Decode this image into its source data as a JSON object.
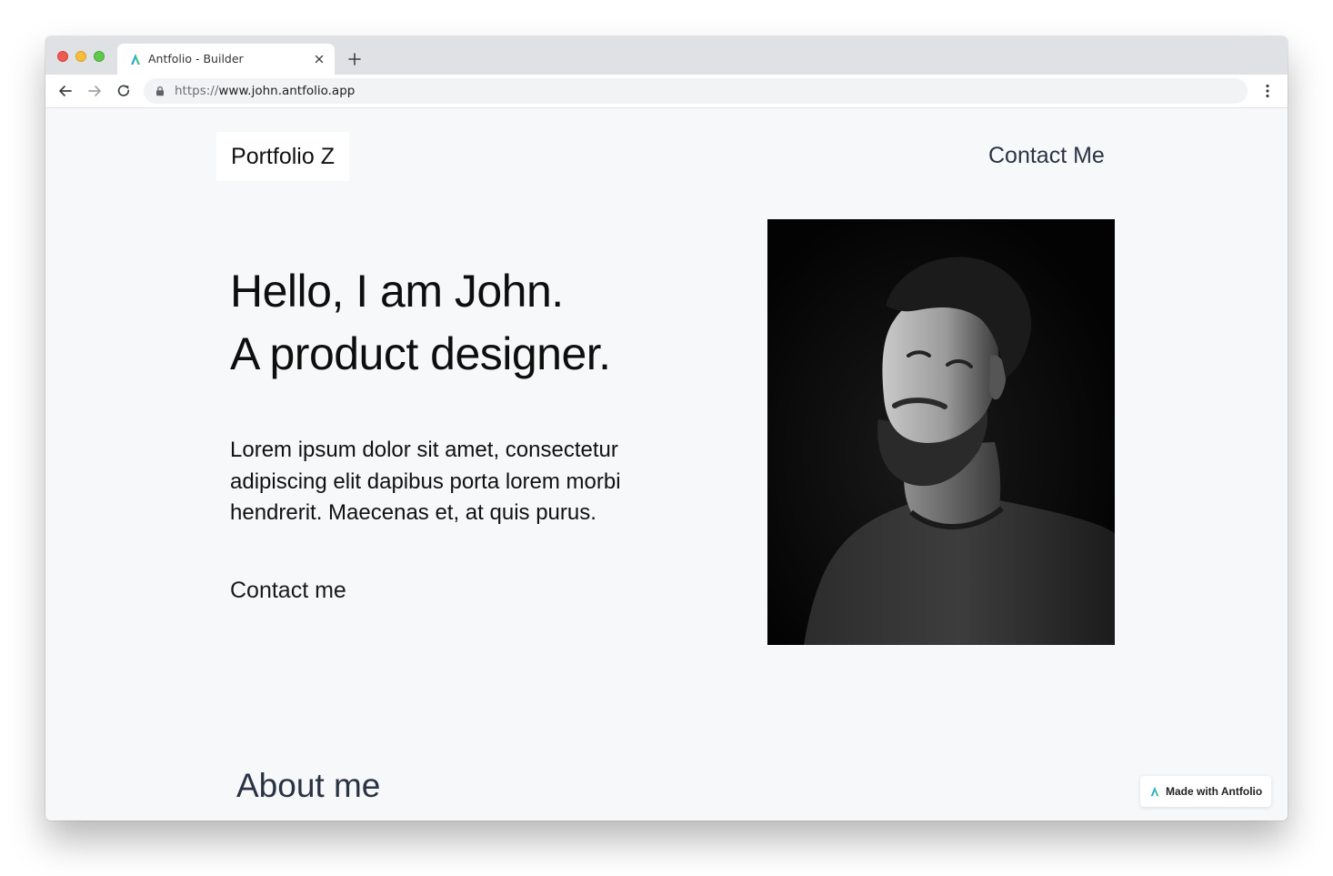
{
  "browser": {
    "tab": {
      "title": "Antfolio - Builder",
      "favicon": "antfolio-logo-icon"
    },
    "url": {
      "scheme": "https://",
      "rest": "www.john.antfolio.app"
    },
    "icons": {
      "back": "arrow-left-icon",
      "forward": "arrow-right-icon",
      "reload": "reload-icon",
      "lock": "lock-icon",
      "menu": "more-vertical-icon",
      "close_tab": "close-icon",
      "new_tab": "plus-icon"
    }
  },
  "site": {
    "brand": "Portfolio Z",
    "nav_contact": "Contact Me",
    "hero": {
      "line1": "Hello, I am John.",
      "line2": "A product designer."
    },
    "intro": "Lorem ipsum dolor sit amet, consectetur adipiscing elit dapibus porta lorem morbi hendrerit. Maecenas et, at quis purus.",
    "contact_link": "Contact me",
    "portrait": "portrait-photo",
    "about_heading": "About me",
    "badge": "Made with Antfolio"
  },
  "colors": {
    "page_bg": "#f7f8fa",
    "nav_text": "#2b3445",
    "heading_text": "#0e0e0e"
  }
}
